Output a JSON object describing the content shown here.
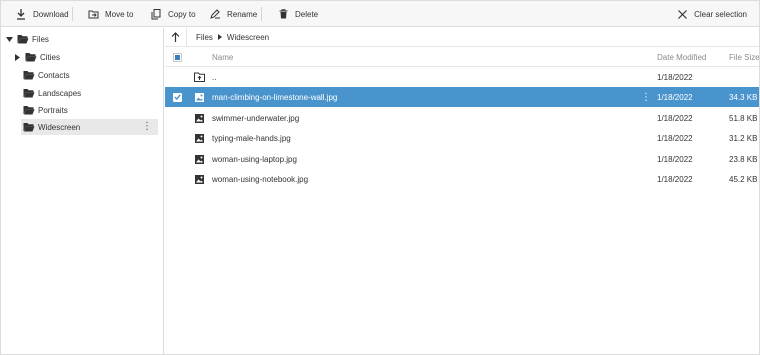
{
  "toolbar": {
    "download": {
      "label": "Download",
      "icon": "download-icon"
    },
    "move": {
      "label": "Move to",
      "icon": "move-to-icon"
    },
    "copy": {
      "label": "Copy to",
      "icon": "copy-icon"
    },
    "rename": {
      "label": "Rename",
      "icon": "rename-icon"
    },
    "delete": {
      "label": "Delete",
      "icon": "trash-icon"
    },
    "clear": {
      "label": "Clear selection",
      "icon": "close-icon"
    }
  },
  "nav": {
    "root": "Files",
    "items": [
      {
        "label": "Cities",
        "has_children": true
      },
      {
        "label": "Contacts"
      },
      {
        "label": "Landscapes"
      },
      {
        "label": "Portraits"
      },
      {
        "label": "Widescreen",
        "selected": true
      }
    ],
    "more_glyph": "⋮"
  },
  "breadcrumb": [
    "Files",
    "Widescreen"
  ],
  "grid": {
    "headers": {
      "name": "Name",
      "date": "Date Modified",
      "size": "File Size"
    },
    "parent_row": {
      "name": "..",
      "date": "1/18/2022"
    },
    "files": [
      {
        "name": "man-climbing-on-limestone-wall.jpg",
        "date": "1/18/2022",
        "size": "34.3 KB",
        "selected": true
      },
      {
        "name": "swimmer-underwater.jpg",
        "date": "1/18/2022",
        "size": "51.8 KB"
      },
      {
        "name": "typing-male-hands.jpg",
        "date": "1/18/2022",
        "size": "31.2 KB"
      },
      {
        "name": "woman-using-laptop.jpg",
        "date": "1/18/2022",
        "size": "23.8 KB"
      },
      {
        "name": "woman-using-notebook.jpg",
        "date": "1/18/2022",
        "size": "45.2 KB"
      }
    ],
    "row_more_glyph": "⋮"
  },
  "colors": {
    "selection": "#4a94cd",
    "accent": "#3a7fc0"
  }
}
